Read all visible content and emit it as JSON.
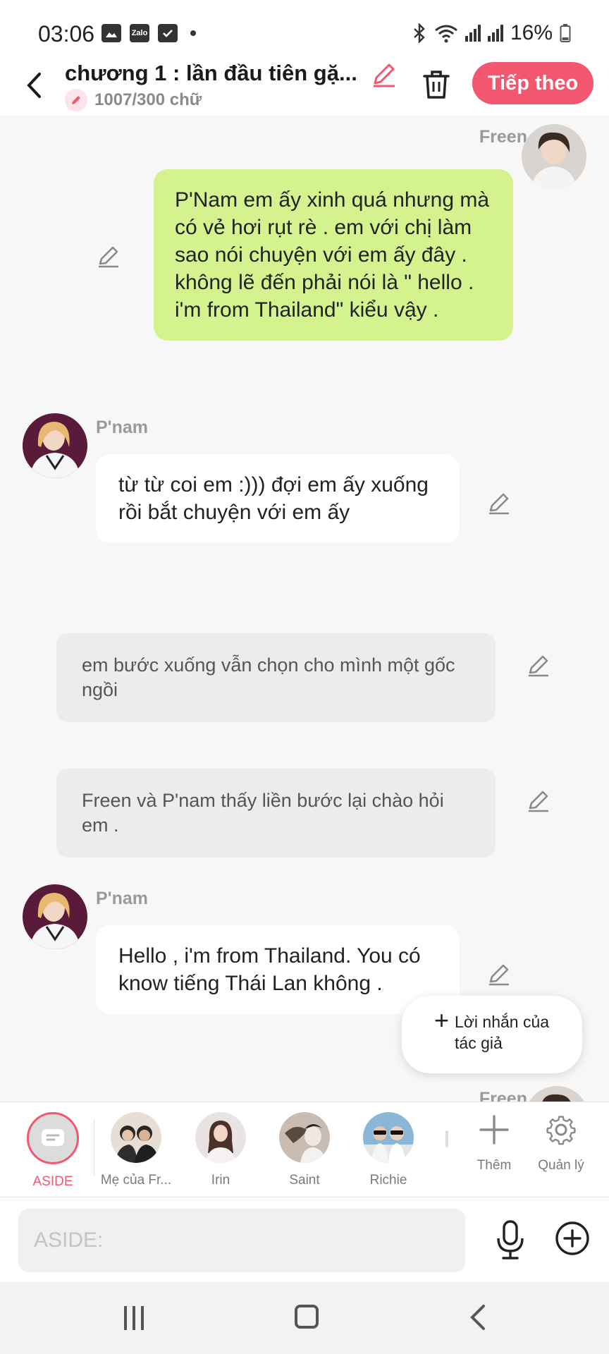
{
  "status_bar": {
    "time": "03:06",
    "battery": "16%",
    "zalo_label": "Zalo"
  },
  "header": {
    "title": "chương 1 : lần đầu tiên gặ...",
    "word_count": "1007/300 chữ",
    "next_label": "Tiếp theo"
  },
  "messages": [
    {
      "type": "right",
      "sender": "Freen",
      "text": "P'Nam em ấy xinh quá nhưng mà có vẻ hơi rụt rè . em với chị làm sao nói chuyện với em ấy đây . không lẽ đến phải nói là \" hello . i'm from Thailand\" kiểu vậy ."
    },
    {
      "type": "left",
      "sender": "P'nam",
      "text": "từ từ coi em :))) đợi em ấy xuống rồi bắt chuyện với em ấy"
    },
    {
      "type": "narration",
      "text": "em bước xuống vẫn chọn cho mình một gốc ngồi"
    },
    {
      "type": "narration",
      "text": "Freen và P'nam thấy liền bước lại chào hỏi em ."
    },
    {
      "type": "left",
      "sender": "P'nam",
      "text": "Hello , i'm from Thailand. You có know tiếng Thái Lan không ."
    },
    {
      "type": "right",
      "sender": "Freen",
      "text": ""
    }
  ],
  "floating_button": {
    "label": "Lời nhắn của tác giả"
  },
  "characters": [
    {
      "label": "ASIDE"
    },
    {
      "label": "Mẹ của Fr..."
    },
    {
      "label": "Irin"
    },
    {
      "label": "Saint"
    },
    {
      "label": "Richie"
    }
  ],
  "tools": {
    "add_label": "Thêm",
    "manage_label": "Quản lý"
  },
  "input": {
    "placeholder": "ASIDE:"
  },
  "colors": {
    "accent": "#f2576f",
    "green_bubble": "#d4f28e",
    "narration_bg": "#ececec"
  }
}
